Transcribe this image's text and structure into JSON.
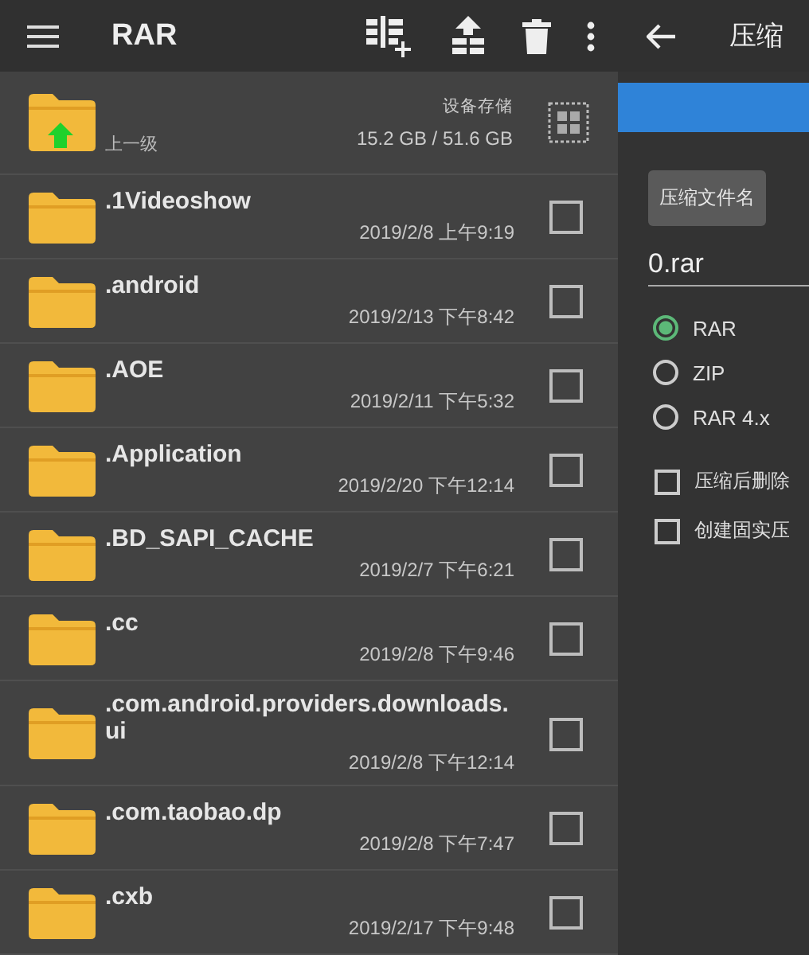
{
  "toolbar": {
    "title": "RAR"
  },
  "parent": {
    "label": "上一级",
    "storage_label": "设备存储",
    "storage": "15.2 GB / 51.6 GB"
  },
  "files": [
    {
      "name": ".1Videoshow",
      "date": "2019/2/8 上午9:19",
      "checked": false
    },
    {
      "name": ".android",
      "date": "2019/2/13 下午8:42",
      "checked": false
    },
    {
      "name": ".AOE",
      "date": "2019/2/11 下午5:32",
      "checked": false
    },
    {
      "name": ".Application",
      "date": "2019/2/20 下午12:14",
      "checked": false
    },
    {
      "name": ".BD_SAPI_CACHE",
      "date": "2019/2/7 下午6:21",
      "checked": false
    },
    {
      "name": ".cc",
      "date": "2019/2/8 下午9:46",
      "checked": false
    },
    {
      "name": ".com.android.providers.downloads.ui",
      "date": "2019/2/8 下午12:14",
      "checked": false
    },
    {
      "name": ".com.taobao.dp",
      "date": "2019/2/8 下午7:47",
      "checked": false
    },
    {
      "name": ".cxb",
      "date": "2019/2/17 下午9:48",
      "checked": false
    }
  ],
  "dialog": {
    "title": "压缩",
    "name_button": "压缩文件名",
    "filename": "0.rar",
    "formats": [
      {
        "label": "RAR",
        "selected": true
      },
      {
        "label": "ZIP",
        "selected": false
      },
      {
        "label": "RAR 4.x",
        "selected": false
      }
    ],
    "options": [
      {
        "label": "压缩后删除",
        "checked": false
      },
      {
        "label": "创建固实压",
        "checked": false
      }
    ]
  }
}
